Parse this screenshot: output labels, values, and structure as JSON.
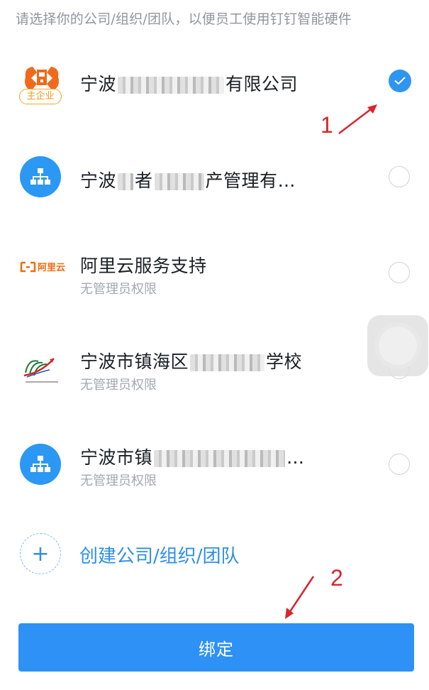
{
  "hint": "请选择你的公司/组织/团队，以便员工使用钉钉智能硬件",
  "organizations": [
    {
      "name_prefix": "宁波",
      "name_suffix": "有限公司",
      "badge": "主企业",
      "subtitle": "",
      "selected": true
    },
    {
      "name_prefix": "宁波",
      "name_mid": "者",
      "name_tail": "产管理有…",
      "subtitle": "",
      "selected": false
    },
    {
      "name": "阿里云服务支持",
      "logo_text": "阿里云",
      "subtitle": "无管理员权限",
      "selected": false
    },
    {
      "name_prefix": "宁波市镇海区",
      "name_suffix": "学校",
      "subtitle": "无管理员权限",
      "selected": false
    },
    {
      "name_prefix": "宁波市镇",
      "name_suffix": "…",
      "subtitle": "无管理员权限",
      "selected": false
    }
  ],
  "create_label": "创建公司/组织/团队",
  "create_icon": "+",
  "bind_label": "绑定",
  "annotations": {
    "first": "1",
    "second": "2"
  },
  "colors": {
    "accent": "#2e91f6",
    "annotation": "#d7262c",
    "badge": "#f6a623"
  }
}
